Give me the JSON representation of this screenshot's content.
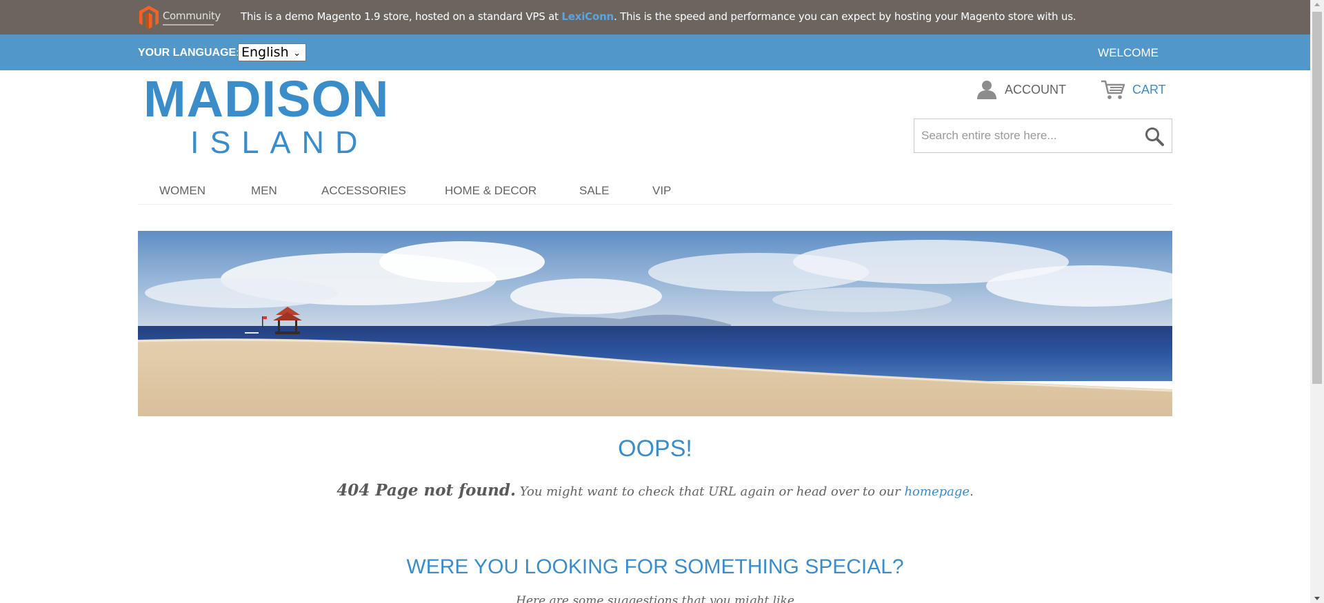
{
  "demo_bar": {
    "logo_text": "Community",
    "notice_prefix": "This is a demo Magento 1.9 store, hosted on a standard VPS at ",
    "notice_link": "LexiConn",
    "notice_suffix": ". This is the speed and performance you can expect by hosting your Magento store with us."
  },
  "lang_bar": {
    "label": "YOUR LANGUAGE:",
    "selected": "English",
    "welcome": "WELCOME"
  },
  "header": {
    "logo_line1": "MADISON",
    "logo_line2": "ISLAND",
    "account_label": "ACCOUNT",
    "cart_label": "CART",
    "search_placeholder": "Search entire store here..."
  },
  "nav": {
    "items": [
      {
        "label": "WOMEN"
      },
      {
        "label": "MEN"
      },
      {
        "label": "ACCESSORIES"
      },
      {
        "label": "HOME & DECOR"
      },
      {
        "label": "SALE"
      },
      {
        "label": "VIP"
      }
    ]
  },
  "content": {
    "oops": "OOPS!",
    "not_found": "404 Page not found.",
    "hint_prefix": " You might want to check that URL again or head over to our ",
    "homepage_link": "homepage",
    "hint_suffix": ".",
    "special_heading": "WERE YOU LOOKING FOR SOMETHING SPECIAL?",
    "suggest_text": "Here are some suggestions that you might like"
  },
  "colors": {
    "demo_bar_bg": "#6b655e",
    "lang_bar_bg": "#5297ca",
    "accent": "#3b8dc9"
  }
}
